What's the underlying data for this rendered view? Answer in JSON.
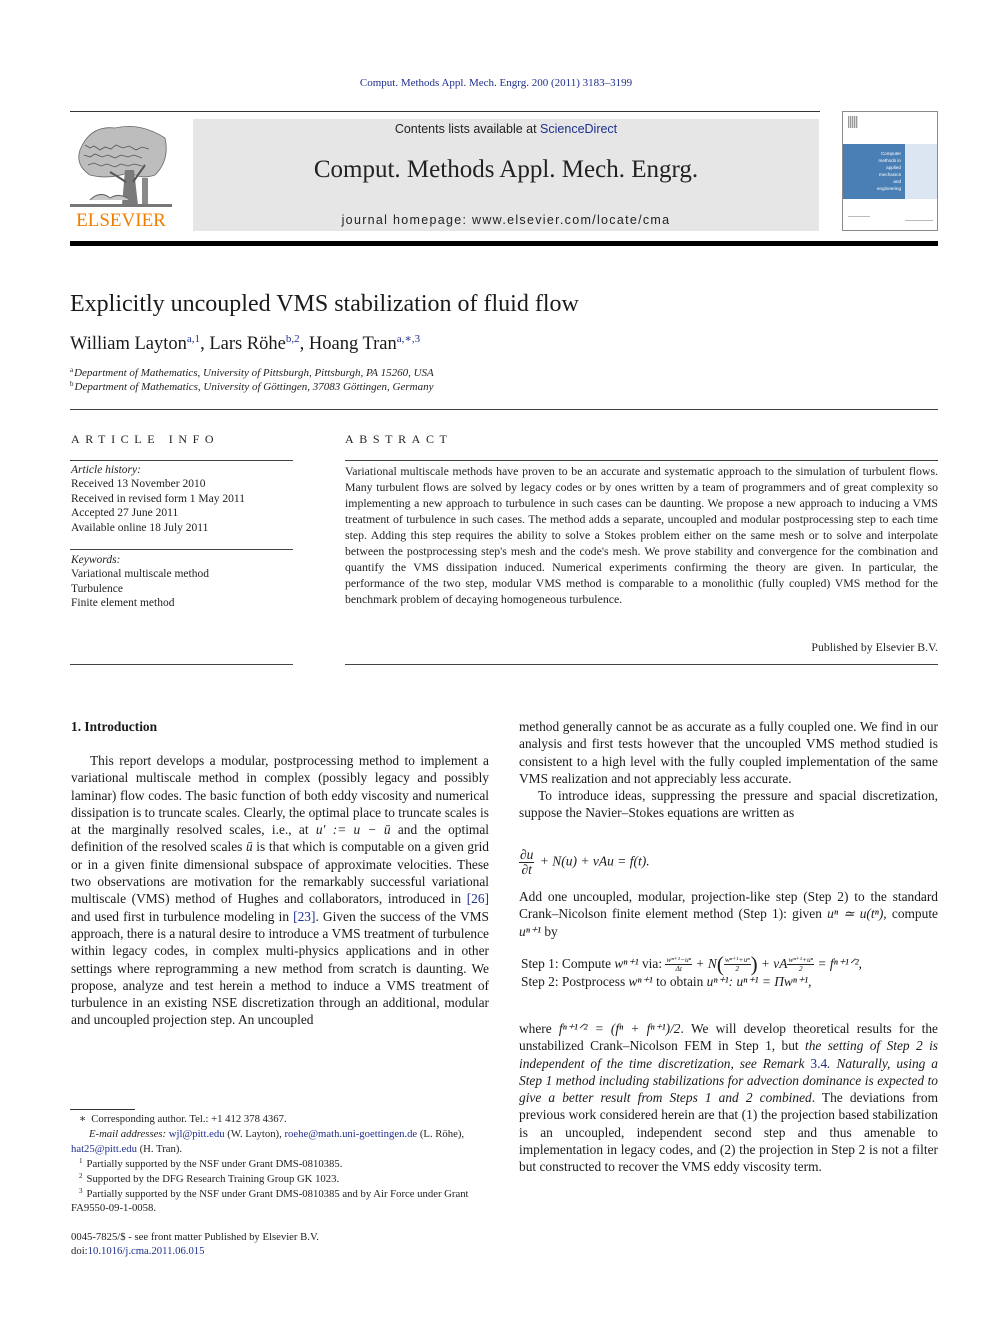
{
  "running_header": "Comput. Methods Appl. Mech. Engrg. 200 (2011) 3183–3199",
  "masthead": {
    "publisher_logo_text": "ELSEVIER",
    "contents_prefix": "Contents lists available at ",
    "contents_link": "ScienceDirect",
    "journal_title": "Comput. Methods Appl. Mech. Engrg.",
    "homepage_prefix": "journal homepage: ",
    "homepage_url": "www.elsevier.com/locate/cma",
    "cover_text": [
      "Computer",
      "methods in",
      "applied",
      "mechanics",
      "and",
      "engineering"
    ]
  },
  "colors": {
    "link": "#1f2f8f",
    "elsevier_orange": "#f07d00",
    "banner_grey": "#e6e6e6",
    "cover_blue": "#4a7fb5"
  },
  "article": {
    "title": "Explicitly uncoupled VMS stabilization of fluid flow",
    "authors": [
      {
        "name": "William Layton",
        "sup": "a,1"
      },
      {
        "name": "Lars Röhe",
        "sup": "b,2"
      },
      {
        "name": "Hoang Tran",
        "sup": "a,∗,3"
      }
    ],
    "affiliations": [
      {
        "mark": "a",
        "text": "Department of Mathematics, University of Pittsburgh, Pittsburgh, PA 15260, USA"
      },
      {
        "mark": "b",
        "text": "Department of Mathematics, University of Göttingen, 37083 Göttingen, Germany"
      }
    ]
  },
  "article_info": {
    "heading": "ARTICLE INFO",
    "history_label": "Article history:",
    "history": [
      "Received 13 November 2010",
      "Received in revised form 1 May 2011",
      "Accepted 27 June 2011",
      "Available online 18 July 2011"
    ],
    "keywords_label": "Keywords:",
    "keywords": [
      "Variational multiscale method",
      "Turbulence",
      "Finite element method"
    ]
  },
  "abstract": {
    "heading": "ABSTRACT",
    "text": "Variational multiscale methods have proven to be an accurate and systematic approach to the simulation of turbulent flows. Many turbulent flows are solved by legacy codes or by ones written by a team of programmers and of great complexity so implementing a new approach to turbulence in such cases can be daunting. We propose a new approach to inducing a VMS treatment of turbulence in such cases. The method adds a separate, uncoupled and modular postprocessing step to each time step. Adding this step requires the ability to solve a Stokes problem either on the same mesh or to solve and interpolate between the postprocessing step's mesh and the code's mesh. We prove stability and convergence for the combination and quantify the VMS dissipation induced. Numerical experiments confirming the theory are given. In particular, the performance of the two step, modular VMS method is comparable to a monolithic (fully coupled) VMS method for the benchmark problem of decaying homogeneous turbulence.",
    "published_by": "Published by Elsevier B.V."
  },
  "body": {
    "section_heading": "1. Introduction",
    "left": {
      "p1_a": "This report develops a modular, postprocessing method to implement a variational multiscale method in complex (possibly legacy and possibly laminar) flow codes. The basic function of both eddy viscosity and numerical dissipation is to truncate scales. Clearly, the optimal place to truncate scales is at the marginally resolved scales, i.e., at ",
      "p1_math1": "u′ := u − ū",
      "p1_b": " and the optimal definition of the resolved scales ",
      "p1_math2": "ū",
      "p1_c": " is that which is computable on a given grid or in a given finite dimensional subspace of approximate velocities. These two observations are motivation for the remarkably successful variational multiscale (VMS) method of Hughes and collaborators, introduced in ",
      "ref1": "[26]",
      "p1_d": " and used first in turbulence modeling in ",
      "ref2": "[23]",
      "p1_e": ". Given the success of the VMS approach, there is a natural desire to introduce a VMS treatment of turbulence within legacy codes, in complex multi-physics applications and in other settings where reprogramming a new method from scratch is daunting. We propose, analyze and test herein a method to induce a VMS treatment of turbulence in an existing NSE discretization through an additional, modular and uncoupled projection step. An uncoupled"
    },
    "right": {
      "p1_cont": "method generally cannot be as accurate as a fully coupled one. We find in our analysis and first tests however that the uncoupled VMS method studied is consistent to a high level with the fully coupled implementation of the same VMS realization and not appreciably less accurate.",
      "p2": "To introduce ideas, suppressing the pressure and spacial discretization, suppose the Navier–Stokes equations are written as",
      "eq1": {
        "num": "∂u",
        "den": "∂t",
        "rest": " + N(u) + νAu = f(t)."
      },
      "p3_a": "Add one uncoupled, modular, projection-like step (Step 2) to the standard Crank–Nicolson finite element method (Step 1): given ",
      "p3_math1": "uⁿ ≃ u(tⁿ)",
      "p3_b": ", compute ",
      "p3_math2": "uⁿ⁺¹",
      "p3_c": " by",
      "step1_label": "Step 1:  Compute ",
      "step1_var": "wⁿ⁺¹",
      "step1_via": " via: ",
      "step1_frac1_num": "wⁿ⁺¹−uⁿ",
      "step1_frac1_den": "Δt",
      "step1_N": " + N",
      "step1_frac2_num": "wⁿ⁺¹+uⁿ",
      "step1_frac2_den": "2",
      "step1_nuA": " + νA",
      "step1_frac3_num": "wⁿ⁺¹+uⁿ",
      "step1_frac3_den": "2",
      "step1_rhs": " = fⁿ⁺¹ᐟ²,",
      "step2_label": "Step 2:  Postprocess ",
      "step2_var": "wⁿ⁺¹",
      "step2_mid": " to obtain ",
      "step2_var2": "uⁿ⁺¹",
      "step2_eq": ": uⁿ⁺¹ =  Πwⁿ⁺¹,",
      "p4_a": "where ",
      "p4_math": "fⁿ⁺¹ᐟ² = (fⁿ + fⁿ⁺¹)/2",
      "p4_b": ". We will develop theoretical results for the unstabilized Crank–Nicolson FEM in Step 1, but ",
      "p4_it1": "the setting of Step 2 is independent of the time discretization, see Remark ",
      "ref3": "3.4",
      "p4_it2": ". Naturally, using a Step 1 method including stabilizations for advection dominance is expected to give a better result from Steps 1 and 2 combined",
      "p4_c": ". The deviations from previous work considered herein are that (1) the projection based stabilization is an uncoupled, independent second step and thus amenable to implementation in legacy codes, and (2) the projection in Step 2 is not a filter but constructed to recover the VMS eddy viscosity term."
    }
  },
  "footnotes": {
    "corresponding": "Corresponding author. Tel.: +1 412 378 4367.",
    "email_label": "E-mail addresses:",
    "emails": [
      {
        "addr": "wjl@pitt.edu",
        "who": " (W. Layton), "
      },
      {
        "addr": "roehe@math.uni-goettingen.de",
        "who": " (L. Röhe), "
      },
      {
        "addr": "hat25@pitt.edu",
        "who": " (H. Tran)."
      }
    ],
    "notes": [
      {
        "mark": "1",
        "text": "Partially supported by the NSF under Grant DMS-0810385."
      },
      {
        "mark": "2",
        "text": "Supported by the DFG Research Training Group GK 1023."
      },
      {
        "mark": "3",
        "text": "Partially supported by the NSF under Grant DMS-0810385 and by Air Force under Grant FA9550-09-1-0058."
      }
    ],
    "front_matter": "0045-7825/$ - see front matter Published by Elsevier B.V.",
    "doi_prefix": "doi:",
    "doi": "10.1016/j.cma.2011.06.015"
  }
}
